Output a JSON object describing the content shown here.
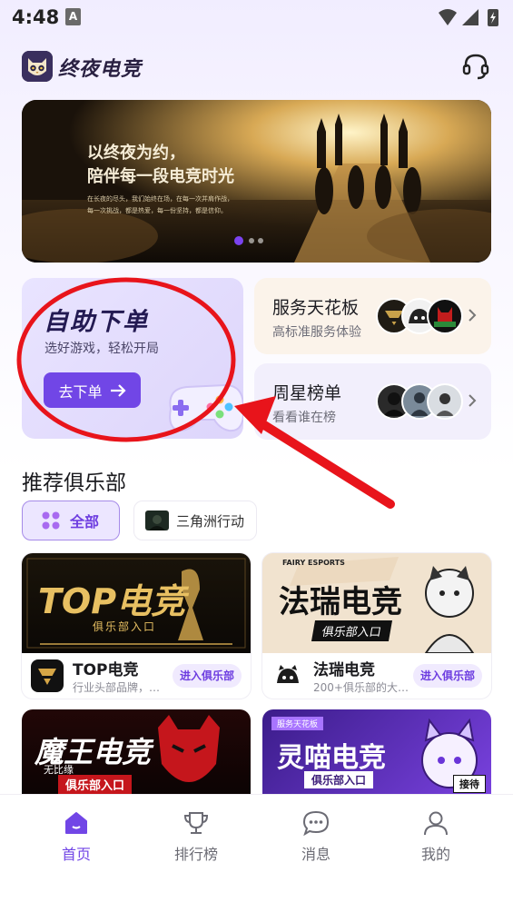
{
  "status_bar": {
    "time": "4:48",
    "notification_icon_letter": "A"
  },
  "header": {
    "app_name": "终夜电竞",
    "support_icon": "headset-icon"
  },
  "banner": {
    "slogan_line1": "以终夜为约，",
    "slogan_line2": "陪伴每一段电竞时光",
    "small_line1": "在长夜的尽头，我们始终在场，在每一次并肩作战，",
    "small_line2": "每一次挑战，都是热爱，每一份坚持，都是信仰。"
  },
  "self_order": {
    "title": "自助下单",
    "subtitle": "选好游戏，轻松开局",
    "button_label": "去下单",
    "button_icon": "arrow-right-icon",
    "decor_icon": "gamepad-icon"
  },
  "service_card": {
    "title": "服务天花板",
    "subtitle": "高标准服务体验"
  },
  "star_card": {
    "title": "周星榜单",
    "subtitle": "看看谁在榜"
  },
  "section": {
    "title": "推荐俱乐部"
  },
  "filters": [
    {
      "label": "全部",
      "icon": "grid-dots-icon",
      "selected": true
    },
    {
      "label": "三角洲行动",
      "icon": "game-thumbnail-icon",
      "selected": false
    }
  ],
  "clubs": [
    {
      "cover_title": "TOP电竞",
      "cover_sub": "俱乐部入口",
      "name": "TOP电竞",
      "desc": "行业头部品牌，…",
      "join_label": "进入俱乐部"
    },
    {
      "cover_title": "法瑞电竞",
      "cover_sub": "俱乐部入口",
      "cover_tag": "FAIRY ESPORTS",
      "name": "法瑞电竞",
      "desc": "200+俱乐部的大…",
      "join_label": "进入俱乐部"
    }
  ],
  "clubs_row2": [
    {
      "cover_title": "魔王电竞",
      "cover_sub": "俱乐部入口",
      "cover_tag": "无比缘"
    },
    {
      "cover_title": "灵喵电竞",
      "cover_sub": "俱乐部入口",
      "cover_tag": "服务天花板",
      "badge": "接待"
    }
  ],
  "tabbar": [
    {
      "label": "首页",
      "icon": "home-icon",
      "active": true
    },
    {
      "label": "排行榜",
      "icon": "trophy-icon",
      "active": false
    },
    {
      "label": "消息",
      "icon": "chat-bubble-icon",
      "active": false
    },
    {
      "label": "我的",
      "icon": "person-icon",
      "active": false
    }
  ],
  "annotation": {
    "shape": "red ellipse and arrow",
    "color": "#e8141b"
  },
  "colors": {
    "accent": "#7146e6",
    "annotation_red": "#e8141b"
  }
}
